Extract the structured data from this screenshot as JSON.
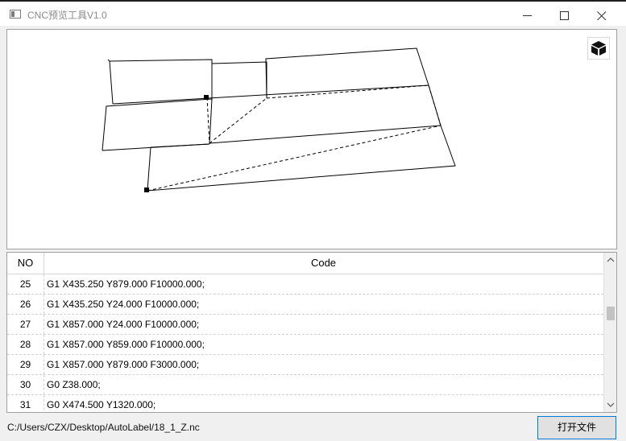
{
  "window": {
    "title": "CNC预览工具V1.0",
    "controls": [
      "minimize-icon",
      "maximize-icon",
      "close-icon"
    ]
  },
  "viewer": {
    "view_button_icon": "cube-icon"
  },
  "table": {
    "columns": [
      "NO",
      "Code"
    ],
    "rows": [
      {
        "no": "25",
        "code": "G1 X435.250 Y879.000 F10000.000;"
      },
      {
        "no": "26",
        "code": "G1 X435.250 Y24.000 F10000.000;"
      },
      {
        "no": "27",
        "code": "G1 X857.000 Y24.000 F10000.000;"
      },
      {
        "no": "28",
        "code": "G1 X857.000 Y859.000 F10000.000;"
      },
      {
        "no": "29",
        "code": "G1 X857.000 Y879.000 F3000.000;"
      },
      {
        "no": "30",
        "code": "G0 Z38.000;"
      },
      {
        "no": "31",
        "code": "G0 X474.500 Y1320.000;"
      }
    ],
    "scroll_position": 0.38
  },
  "footer": {
    "file_path": "C:/Users/CZX/Desktop/AutoLabel/18_1_Z.nc",
    "open_button": "打开文件"
  }
}
